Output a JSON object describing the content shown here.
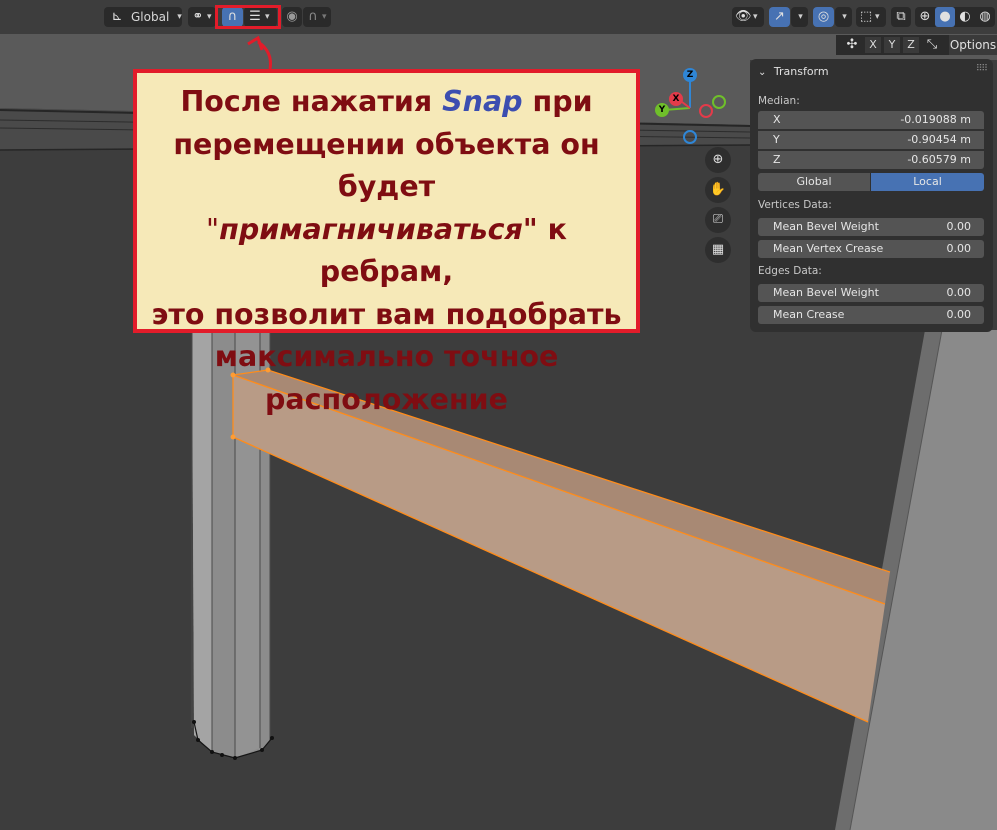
{
  "toolbar": {
    "orientation_label": "Global",
    "options_label": "Options"
  },
  "callout": {
    "line1_a": "После нажатия ",
    "line1_snap": "Snap",
    "line1_b": " при",
    "line2": "перемещении объекта он будет",
    "line3_q1": "\"",
    "line3_em": "примагничиваться",
    "line3_b": "\" к ребрам,",
    "line4": "это позволит вам подобрать",
    "line5": "максимально точное",
    "line6": "расположение"
  },
  "gizmo": {
    "z": "Z",
    "y": "Y",
    "x": "X"
  },
  "transform_panel": {
    "title": "Transform",
    "median_label": "Median:",
    "fields": [
      {
        "key": "X",
        "value": "-0.019088 m"
      },
      {
        "key": "Y",
        "value": "-0.90454 m"
      },
      {
        "key": "Z",
        "value": "-0.60579 m"
      }
    ],
    "global_label": "Global",
    "local_label": "Local",
    "vertices_label": "Vertices Data:",
    "vertex_fields": [
      {
        "key": "Mean Bevel Weight",
        "value": "0.00"
      },
      {
        "key": "Mean Vertex Crease",
        "value": "0.00"
      }
    ],
    "edges_label": "Edges Data:",
    "edge_fields": [
      {
        "key": "Mean Bevel Weight",
        "value": "0.00"
      },
      {
        "key": "Mean Crease",
        "value": "0.00"
      }
    ]
  },
  "colors": {
    "accent": "#4772b3",
    "callout_border": "#e21c2a",
    "callout_bg": "#f6e9b8",
    "callout_text": "#7f0d12",
    "selection": "#ff8c1a"
  }
}
